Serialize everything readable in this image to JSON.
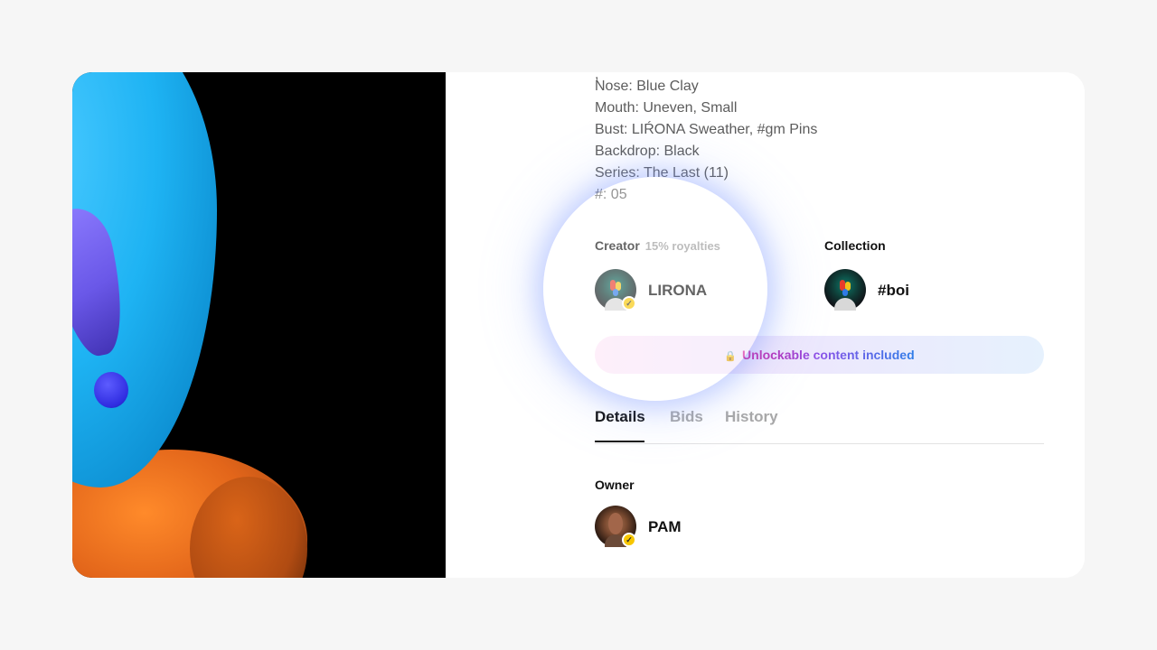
{
  "properties": [
    "Nose: Blue Clay",
    "Mouth: Uneven, Small",
    "Bust: LIŔONA Sweather, #gm Pins",
    "Backdrop: Black",
    "Series: The Last (11)",
    "#: 05"
  ],
  "creator": {
    "label": "Creator",
    "royalties": "15% royalties",
    "name": "LIRONA",
    "verified_icon": "check-badge-icon"
  },
  "collection": {
    "label": "Collection",
    "name": "#boi"
  },
  "unlockable": {
    "icon": "lock-icon",
    "text": "Unlockable content included"
  },
  "tabs": [
    {
      "label": "Details",
      "active": true
    },
    {
      "label": "Bids",
      "active": false
    },
    {
      "label": "History",
      "active": false
    }
  ],
  "owner": {
    "label": "Owner",
    "name": "PAM",
    "verified_icon": "check-badge-icon"
  },
  "colors": {
    "page_background": "#f6f6f6",
    "card_background": "#ffffff",
    "verified_badge": "#f7c600",
    "unlock_pink": "#d61f9c",
    "unlock_blue": "#2f7de8"
  }
}
